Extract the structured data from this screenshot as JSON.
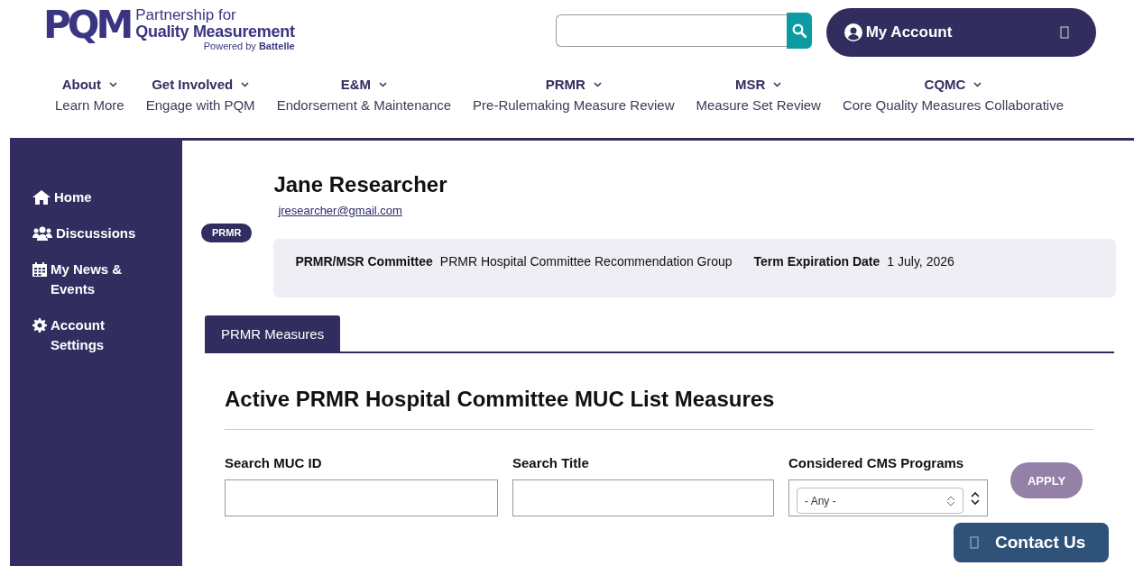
{
  "logo": {
    "mark": "PQM",
    "line1": "Partnership for",
    "line2": "Quality Measurement",
    "powered": "Powered by **Battelle**"
  },
  "account": {
    "label": "My Account"
  },
  "nav": [
    {
      "label": "About",
      "subtitle": "Learn More"
    },
    {
      "label": "Get Involved",
      "subtitle": "Engage with PQM"
    },
    {
      "label": "E&M",
      "subtitle": "Endorsement & Maintenance"
    },
    {
      "label": "PRMR",
      "subtitle": "Pre-Rulemaking Measure Review"
    },
    {
      "label": "MSR",
      "subtitle": "Measure Set Review"
    },
    {
      "label": "CQMC",
      "subtitle": "Core Quality Measures Collaborative"
    }
  ],
  "sidebar": {
    "items": [
      {
        "kind": "home",
        "label": "Home"
      },
      {
        "kind": "people",
        "label": "Discussions"
      },
      {
        "kind": "calendar",
        "label": "My News & Events"
      },
      {
        "kind": "gear",
        "label": "Account Settings"
      }
    ]
  },
  "profile": {
    "name": "Jane Researcher",
    "email": "jresearcher@gmail.com",
    "badge": "PRMR",
    "committee_label": "PRMR/MSR Committee",
    "committee_value": "PRMR Hospital Committee Recommendation Group",
    "term_label": "Term Expiration Date",
    "term_value": "1 July, 2026"
  },
  "tabs": [
    {
      "label": "PRMR Measures",
      "selected": true
    }
  ],
  "section": {
    "title": "Active PRMR Hospital Committee MUC List Measures",
    "filters": [
      {
        "kind": "text",
        "label": "Search MUC ID"
      },
      {
        "kind": "text",
        "label": "Search Title"
      },
      {
        "kind": "select",
        "label": "Considered CMS Programs",
        "value": "- Any -"
      }
    ],
    "apply": "APPLY"
  },
  "contact": {
    "label": "Contact Us"
  }
}
